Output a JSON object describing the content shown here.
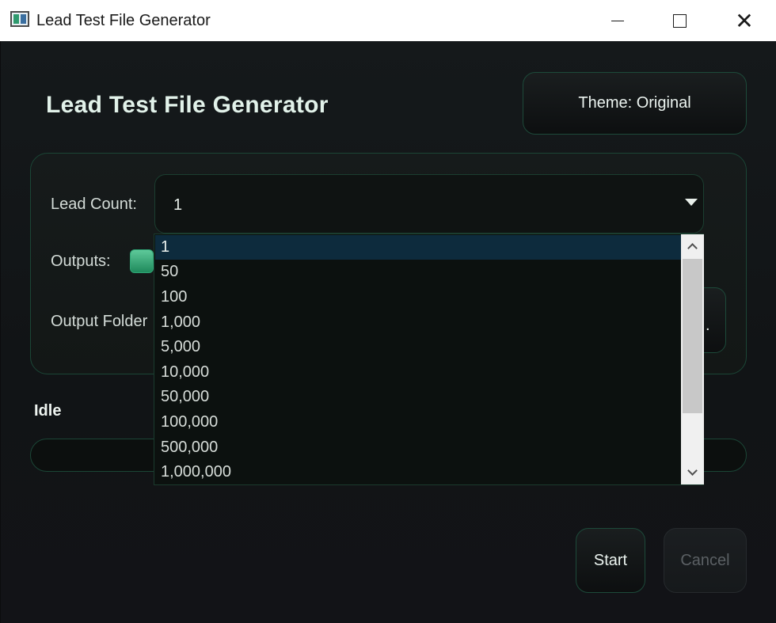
{
  "window": {
    "title": "Lead Test File Generator"
  },
  "header": {
    "title": "Lead Test File Generator",
    "theme_button": "Theme: Original"
  },
  "form": {
    "lead_count_label": "Lead Count:",
    "lead_count_value": "1",
    "outputs_label": "Outputs:",
    "outputs_enabled": true,
    "output_folder_label": "Output Folder",
    "browse_label": "."
  },
  "dropdown": {
    "selected": "1",
    "options": [
      "1",
      "50",
      "100",
      "1,000",
      "5,000",
      "10,000",
      "50,000",
      "100,000",
      "500,000",
      "1,000,000"
    ]
  },
  "status": {
    "text": "Idle",
    "progress": 0
  },
  "actions": {
    "start": "Start",
    "cancel": "Cancel"
  },
  "colors": {
    "accent": "#2fa575",
    "border": "#1b4636",
    "selection": "#0d2b3d"
  }
}
